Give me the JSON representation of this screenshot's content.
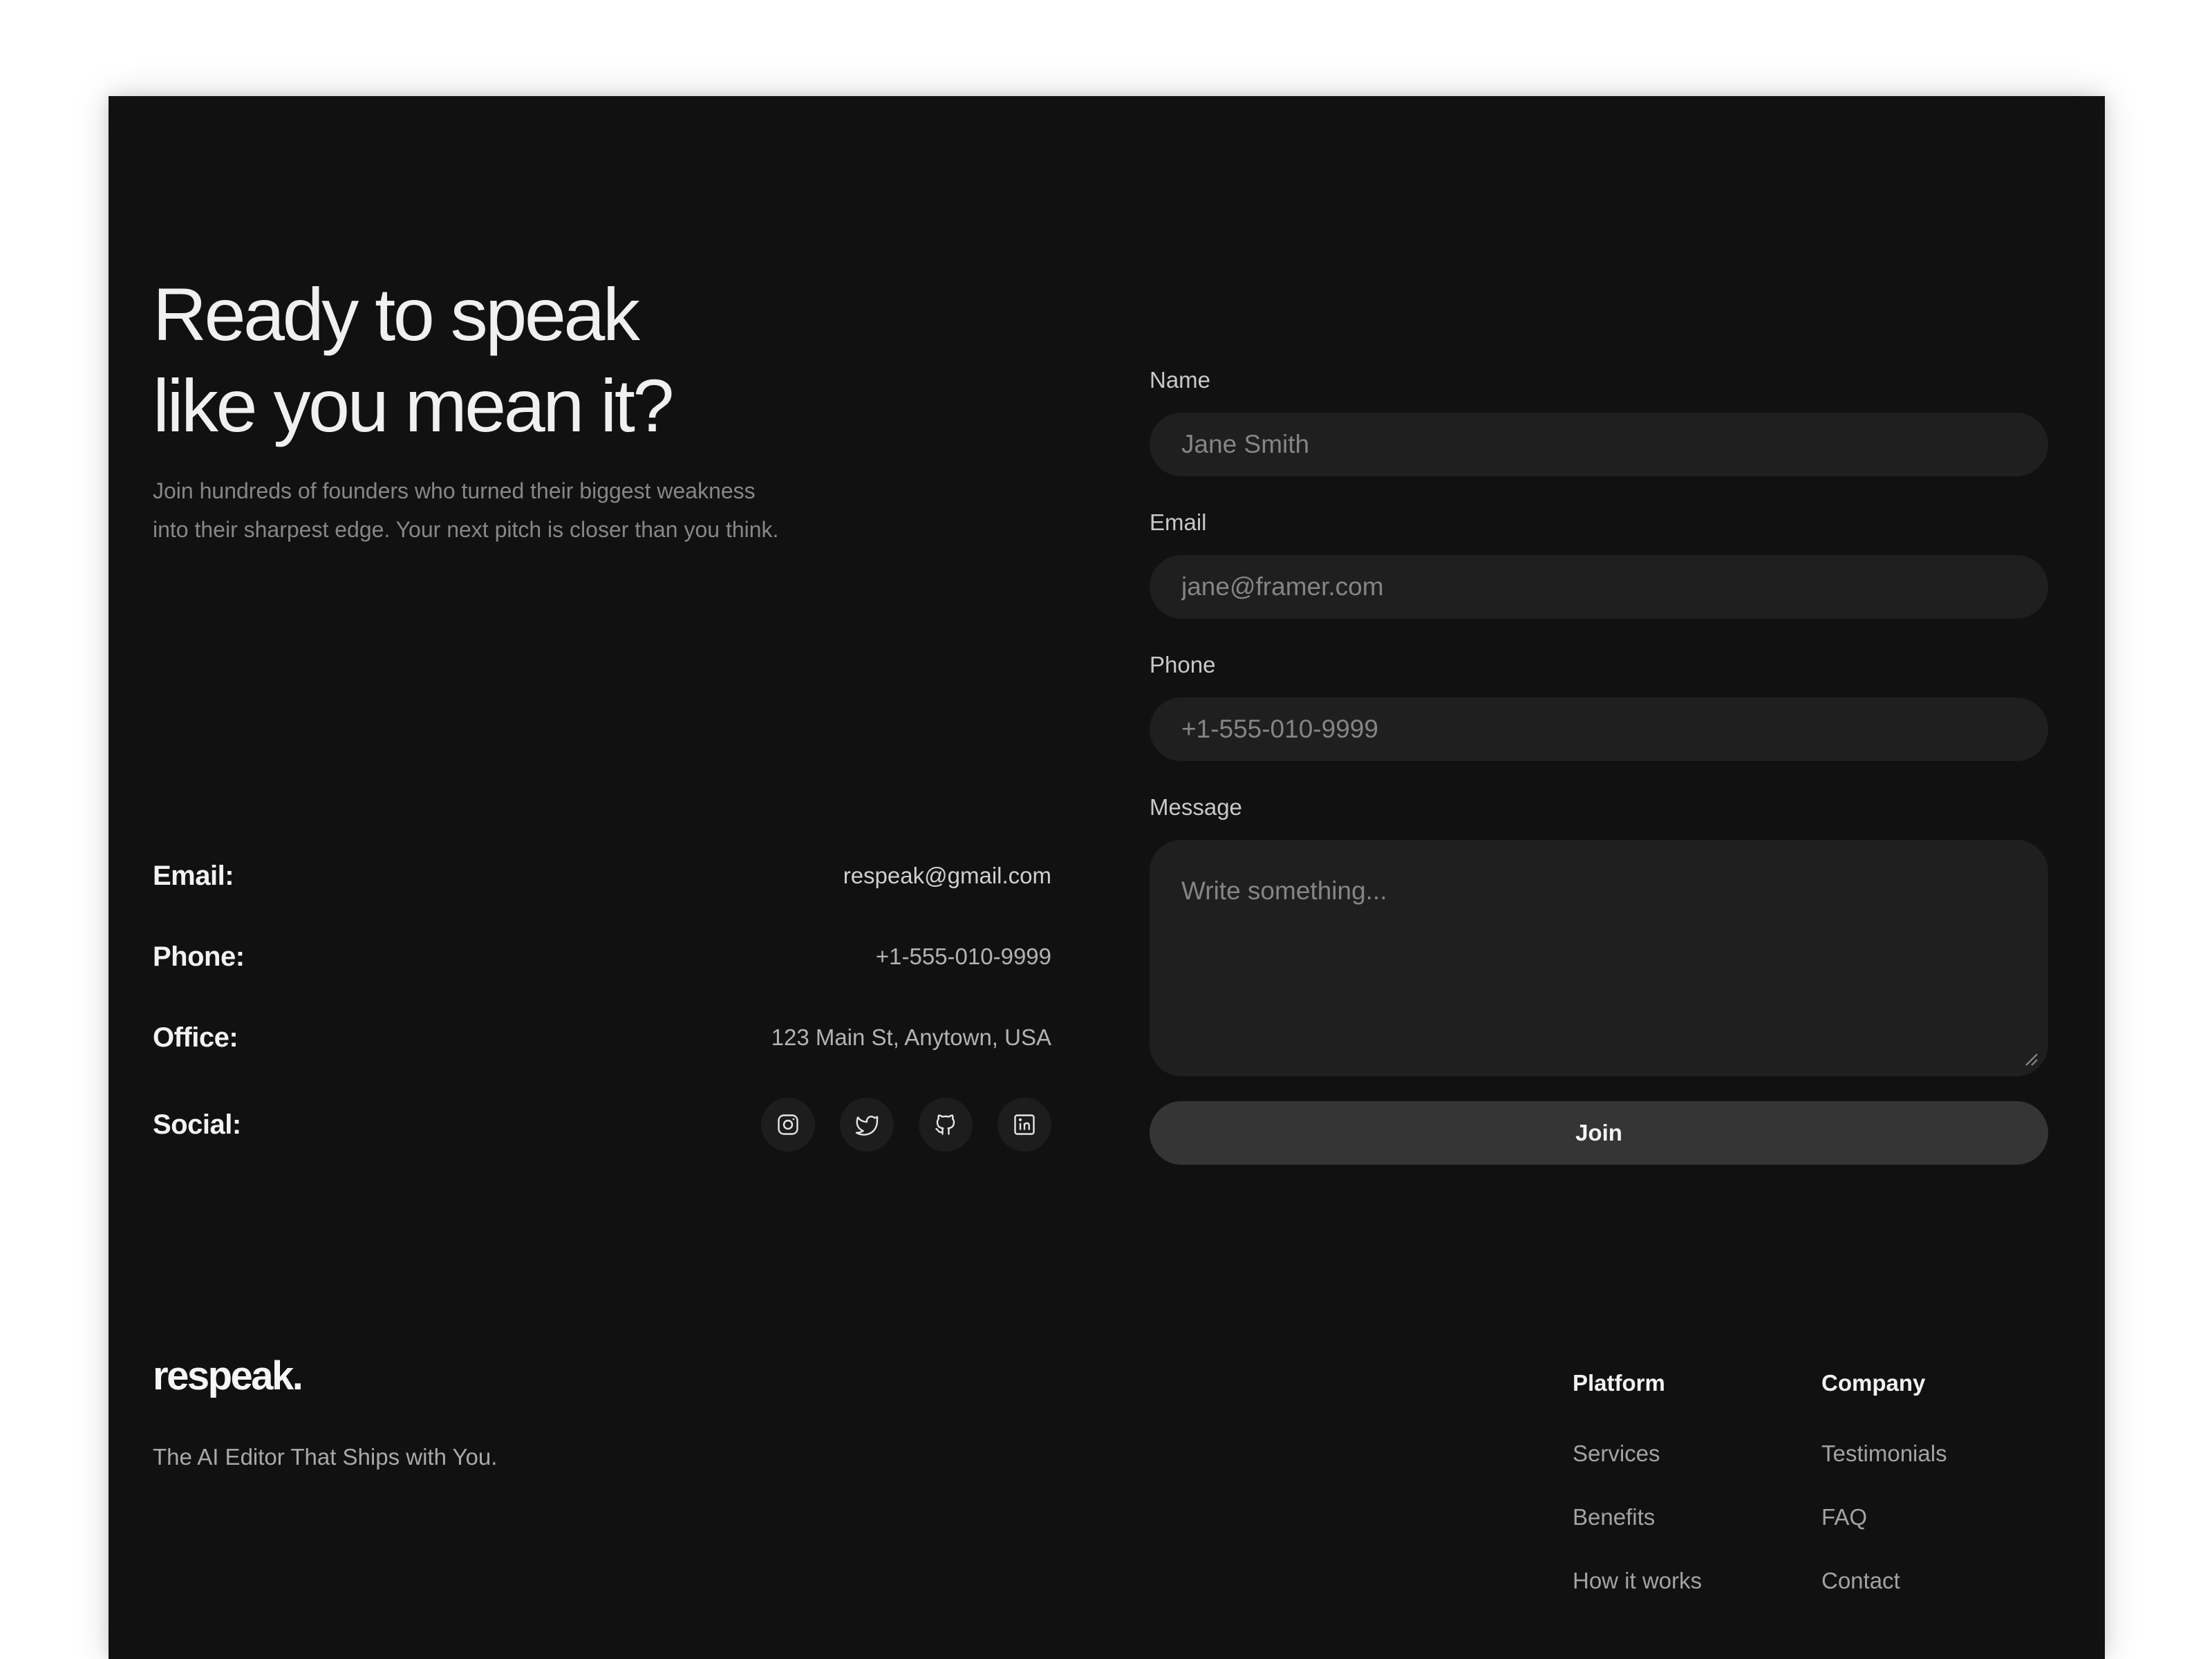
{
  "hero": {
    "headline_line1": "Ready to speak",
    "headline_line2": "like you mean it?",
    "subtext_line1": "Join hundreds of founders who turned their biggest weakness",
    "subtext_line2": "into their sharpest edge. Your next pitch is closer than you think."
  },
  "contact": {
    "email_label": "Email:",
    "email_value": "respeak@gmail.com",
    "phone_label": "Phone:",
    "phone_value": "+1-555-010-9999",
    "office_label": "Office:",
    "office_value": "123 Main St, Anytown, USA",
    "social_label": "Social:",
    "social_icons": [
      "instagram-icon",
      "twitter-icon",
      "github-icon",
      "linkedin-icon"
    ]
  },
  "form": {
    "name_label": "Name",
    "name_placeholder": "Jane Smith",
    "email_label": "Email",
    "email_placeholder": "jane@framer.com",
    "phone_label": "Phone",
    "phone_placeholder": "+1-555-010-9999",
    "message_label": "Message",
    "message_placeholder": "Write something...",
    "submit_label": "Join"
  },
  "footer": {
    "logo": "respeak.",
    "tagline": "The AI Editor That Ships with You.",
    "platform": {
      "title": "Platform",
      "links": [
        "Services",
        "Benefits",
        "How it works"
      ]
    },
    "company": {
      "title": "Company",
      "links": [
        "Testimonials",
        "FAQ",
        "Contact"
      ]
    }
  },
  "colors": {
    "background": "#111111",
    "input_background": "#1f1f1f",
    "button_background": "#353535",
    "text_primary": "#f2f2f2",
    "text_muted": "#878787"
  }
}
